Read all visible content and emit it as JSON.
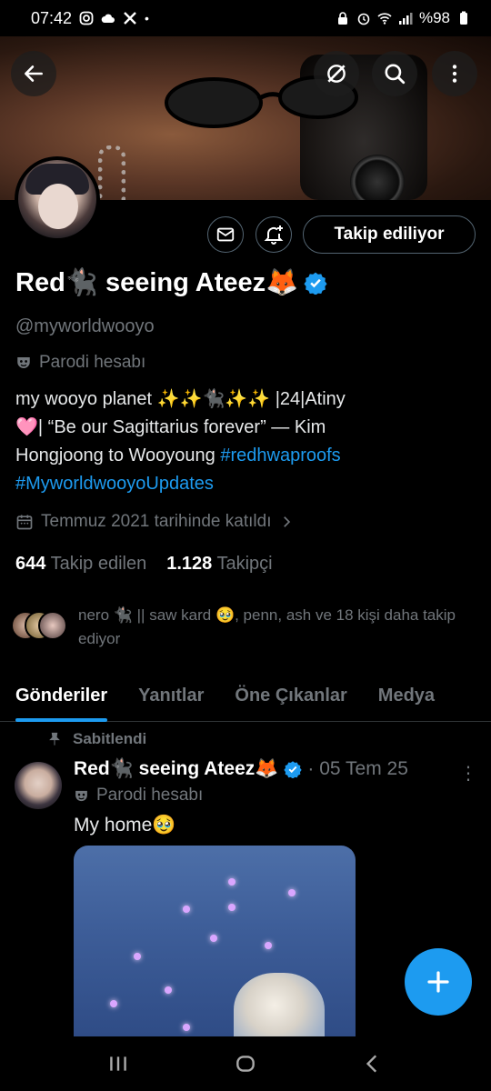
{
  "status_bar": {
    "time": "07:42",
    "battery": "%98",
    "left_icons": [
      "instagram-icon",
      "cloud-icon",
      "x-icon",
      "dot-icon"
    ],
    "right_icons": [
      "lock-icon",
      "alarm-icon",
      "wifi-icon",
      "signal-icon",
      "battery-icon"
    ]
  },
  "header": {
    "back_icon": "back-arrow-icon",
    "grok_icon": "grok-icon",
    "search_icon": "search-icon",
    "more_icon": "more-vertical-icon"
  },
  "profile": {
    "name": "Red🐈‍⬛ seeing Ateez🦊",
    "handle": "@myworldwooyo",
    "label": "Parodi hesabı",
    "bio_line1": "my wooyo planet  ✨✨🐈‍⬛✨✨ |24|Atiny",
    "bio_line2": "🩷| “Be our Sagittarius forever” — Kim",
    "bio_line3": "Hongjoong to Wooyoung ",
    "bio_tag1": "#redhwaproofs",
    "bio_tag2": "#MyworldwooyoUpdates",
    "joined": "Temmuz 2021 tarihinde katıldı",
    "following_count": "644",
    "following_label": "Takip edilen",
    "followers_count": "1.128",
    "followers_label": "Takipçi",
    "known_followers": "nero 🐈‍⬛ || saw kard 🥹, penn, ash ve 18 kişi daha takip ediyor",
    "follow_button": "Takip ediliyor"
  },
  "tabs": [
    {
      "label": "Gönderiler",
      "active": true
    },
    {
      "label": "Yanıtlar",
      "active": false
    },
    {
      "label": "Öne Çıkanlar",
      "active": false
    },
    {
      "label": "Medya",
      "active": false
    }
  ],
  "pinned_post": {
    "pinned_label": "Sabitlendi",
    "author": "Red🐈‍⬛ seeing Ateez🦊",
    "date": "· 05 Tem 25",
    "label": "Parodi hesabı",
    "text": "My home🥹"
  },
  "colors": {
    "accent": "#1d9bf0",
    "secondary_text": "#71767b",
    "background": "#000000"
  }
}
